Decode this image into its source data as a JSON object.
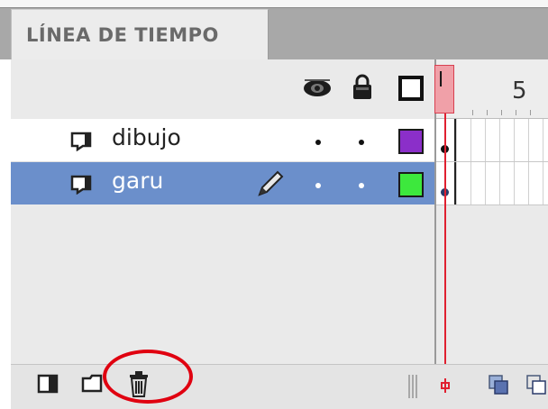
{
  "panel": {
    "tab_title": "LÍNEA DE TIEMPO"
  },
  "header": {
    "icons": [
      "eye-icon",
      "lock-icon",
      "outline-icon"
    ],
    "ruler_label": "5",
    "playhead_label": "l"
  },
  "layers": [
    {
      "name": "dibujo",
      "selected": false,
      "outline_color": "#8b2fc9",
      "show_pencil": false
    },
    {
      "name": "garu",
      "selected": true,
      "outline_color": "#3de83d",
      "show_pencil": true
    }
  ],
  "toolbar": {
    "icons": [
      "new-layer-icon",
      "new-folder-icon",
      "delete-layer-icon"
    ],
    "right_icons": [
      "center-frame-icon",
      "onion-skin-icon",
      "onion-skin-outlines-icon"
    ]
  },
  "colors": {
    "selected_row": "#6b8fcb",
    "playhead": "#e02030",
    "annotation": "#e00010"
  }
}
